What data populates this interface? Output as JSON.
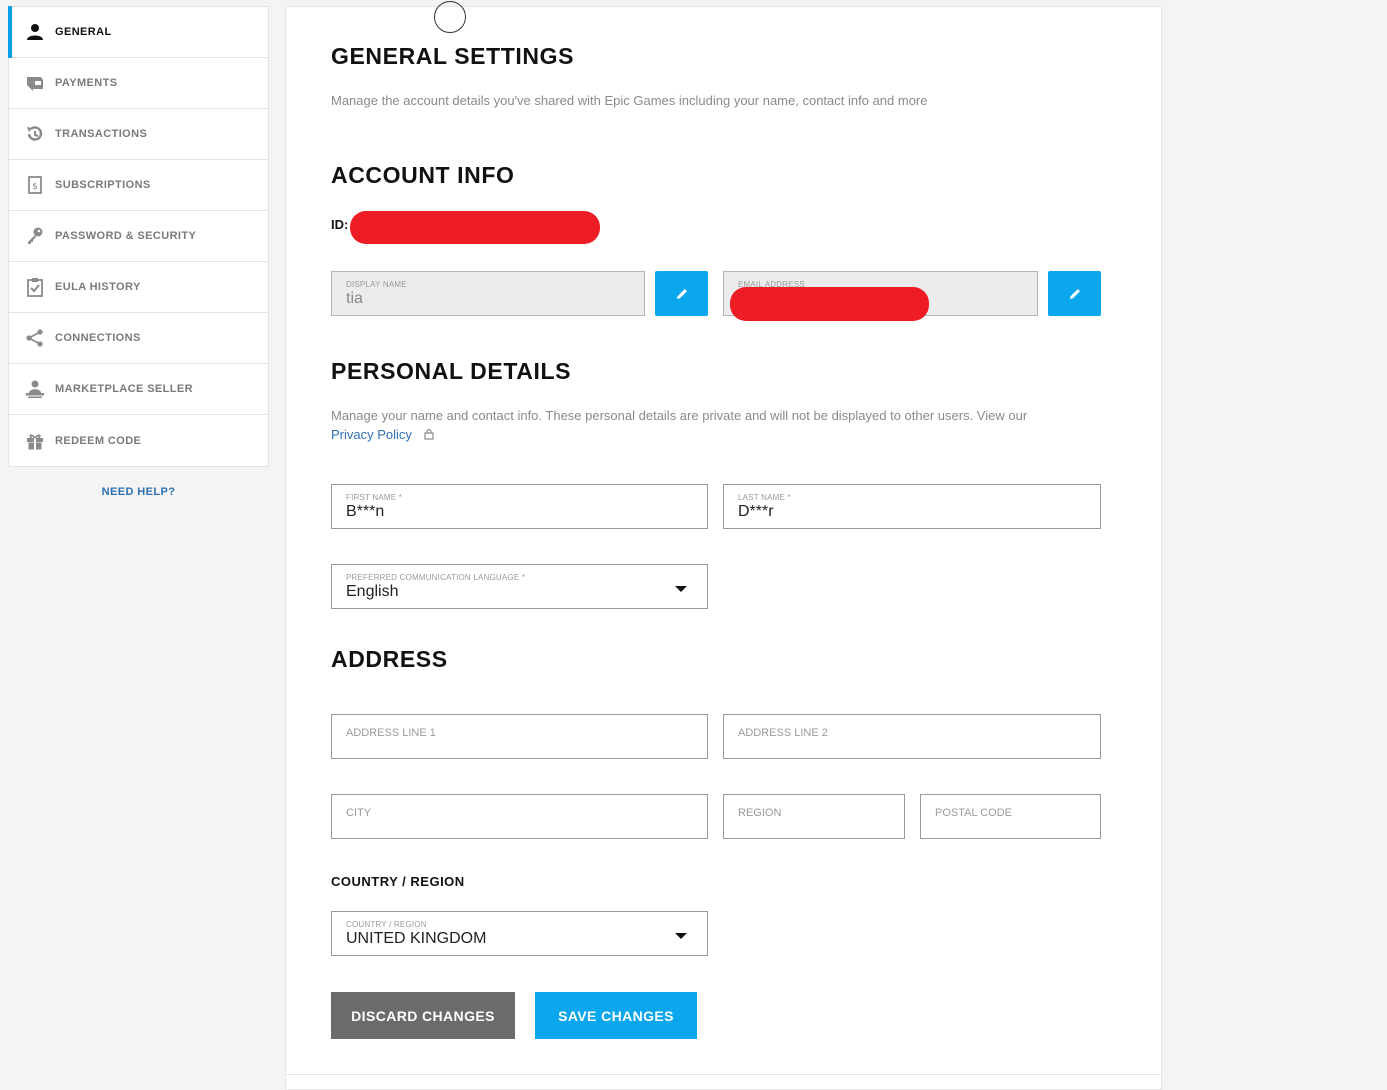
{
  "sidebar": {
    "items": [
      {
        "label": "GENERAL",
        "icon": "user-icon",
        "active": true
      },
      {
        "label": "PAYMENTS",
        "icon": "wallet-icon",
        "active": false
      },
      {
        "label": "TRANSACTIONS",
        "icon": "history-icon",
        "active": false
      },
      {
        "label": "SUBSCRIPTIONS",
        "icon": "receipt-icon",
        "active": false
      },
      {
        "label": "PASSWORD & SECURITY",
        "icon": "key-icon",
        "active": false
      },
      {
        "label": "EULA HISTORY",
        "icon": "clipboard-check-icon",
        "active": false
      },
      {
        "label": "CONNECTIONS",
        "icon": "share-icon",
        "active": false
      },
      {
        "label": "MARKETPLACE SELLER",
        "icon": "seller-icon",
        "active": false
      },
      {
        "label": "REDEEM CODE",
        "icon": "gift-icon",
        "active": false
      }
    ],
    "need_help": "NEED HELP?"
  },
  "general": {
    "title": "GENERAL SETTINGS",
    "description": "Manage the account details you've shared with Epic Games including your name, contact info and more"
  },
  "account_info": {
    "title": "ACCOUNT INFO",
    "id_label": "ID:",
    "display_name_label": "DISPLAY NAME",
    "display_name_value": "tia",
    "email_label": "EMAIL ADDRESS"
  },
  "personal_details": {
    "title": "PERSONAL DETAILS",
    "description": "Manage your name and contact info. These personal details are private and will not be displayed to other users. View our",
    "privacy_link": "Privacy Policy",
    "first_name_label": "FIRST NAME *",
    "first_name_value": "B***n",
    "last_name_label": "LAST NAME *",
    "last_name_value": "D***r",
    "language_label": "PREFERRED COMMUNICATION LANGUAGE *",
    "language_value": "English"
  },
  "address": {
    "title": "ADDRESS",
    "line1_placeholder": "ADDRESS LINE 1",
    "line2_placeholder": "ADDRESS LINE 2",
    "city_placeholder": "CITY",
    "region_placeholder": "REGION",
    "postal_placeholder": "POSTAL CODE",
    "country_heading": "COUNTRY / REGION",
    "country_label": "COUNTRY / REGION",
    "country_value": "UNITED KINGDOM"
  },
  "actions": {
    "discard": "DISCARD CHANGES",
    "save": "SAVE CHANGES"
  },
  "colors": {
    "accent": "#0aa6ee",
    "redaction": "#ee1c25",
    "discard": "#6b6b6b",
    "link": "#2f6fb5"
  }
}
